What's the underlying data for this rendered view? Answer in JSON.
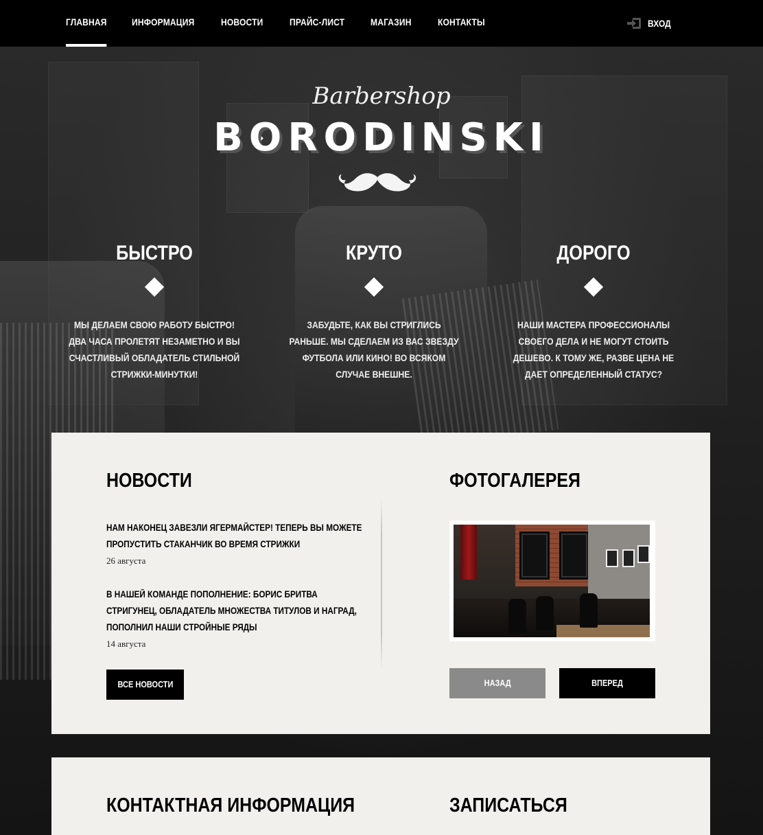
{
  "nav": {
    "items": [
      {
        "label": "ГЛАВНАЯ",
        "active": true
      },
      {
        "label": "ИНФОРМАЦИЯ",
        "active": false
      },
      {
        "label": "НОВОСТИ",
        "active": false
      },
      {
        "label": "ПРАЙС-ЛИСТ",
        "active": false
      },
      {
        "label": "МАГАЗИН",
        "active": false
      },
      {
        "label": "КОНТАКТЫ",
        "active": false
      }
    ],
    "login_label": "ВХОД",
    "login_icon": "login-arrow-icon"
  },
  "hero": {
    "script": "Barbershop",
    "title": "BORODINSKI",
    "emblem_icon": "mustache-icon"
  },
  "features": [
    {
      "title": "БЫСТРО",
      "text": "МЫ ДЕЛАЕМ СВОЮ РАБОТУ БЫСТРО! ДВА ЧАСА ПРОЛЕТЯТ НЕЗАМЕТНО И ВЫ СЧАСТЛИВЫЙ ОБЛАДАТЕЛЬ СТИЛЬНОЙ СТРИЖКИ-МИНУТКИ!"
    },
    {
      "title": "КРУТО",
      "text": "ЗАБУДЬТЕ, КАК ВЫ СТРИГЛИСЬ РАНЬШЕ. МЫ СДЕЛАЕМ ИЗ ВАС ЗВЕЗДУ ФУТБОЛА ИЛИ КИНО! ВО ВСЯКОМ СЛУЧАЕ ВНЕШНЕ."
    },
    {
      "title": "ДОРОГО",
      "text": "НАШИ МАСТЕРА ПРОФЕССИОНАЛЫ СВОЕГО ДЕЛА И НЕ МОГУТ СТОИТЬ ДЕШЕВО. К ТОМУ ЖЕ, РАЗВЕ ЦЕНА НЕ ДАЕТ ОПРЕДЕЛЕННЫЙ СТАТУС?"
    }
  ],
  "news": {
    "heading": "НОВОСТИ",
    "items": [
      {
        "title": "НАМ НАКОНЕЦ ЗАВЕЗЛИ ЯГЕРМАЙСТЕР! ТЕПЕРЬ ВЫ МОЖЕТЕ ПРОПУСТИТЬ СТАКАНЧИК ВО ВРЕМЯ СТРИЖКИ",
        "date": "26 августа"
      },
      {
        "title": "В НАШЕЙ КОМАНДЕ ПОПОЛНЕНИЕ: БОРИС БРИТВА СТРИГУНЕЦ, ОБЛАДАТЕЛЬ МНОЖЕСТВА ТИТУЛОВ И НАГРАД, ПОПОЛНИЛ НАШИ СТРОЙНЫЕ РЯДЫ",
        "date": "14 августа"
      }
    ],
    "all_button": "ВСЕ НОВОСТИ"
  },
  "gallery": {
    "heading": "ФОТОГАЛЕРЕЯ",
    "prev_button": "НАЗАД",
    "next_button": "ВПЕРЕД"
  },
  "contacts": {
    "heading": "КОНТАКТНАЯ ИНФОРМАЦИЯ"
  },
  "signup": {
    "heading": "ЗАПИСАТЬСЯ"
  },
  "colors": {
    "nav_bg": "#000000",
    "panel_bg": "#f2f0ed",
    "button_dark": "#000000",
    "button_disabled": "#8a8a8a"
  }
}
